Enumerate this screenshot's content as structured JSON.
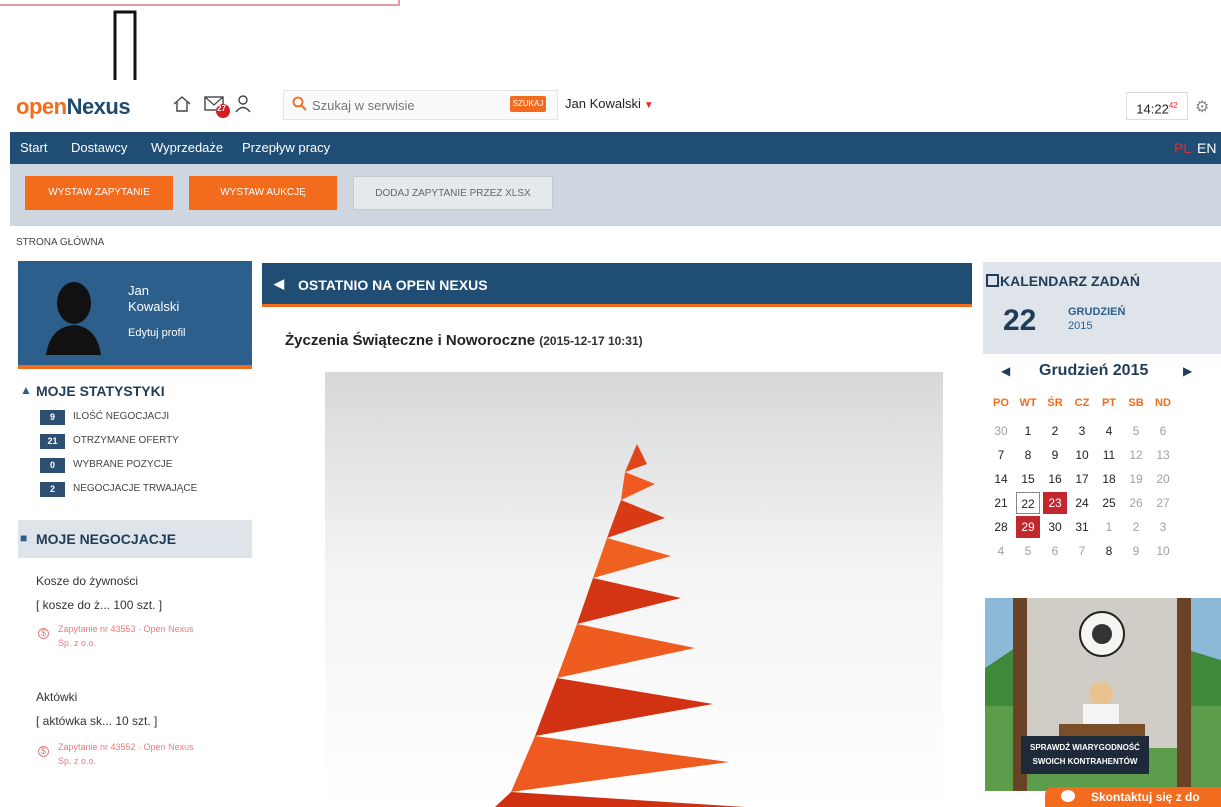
{
  "header": {
    "logo_part1": "open",
    "logo_part2": "Nexus",
    "search_placeholder": "Szukaj w serwisie",
    "search_button": "SZUKAJ",
    "messages_badge": "27",
    "user_name": "Jan Kowalski",
    "clock_time": "14:22",
    "clock_seconds": "42",
    "icons": [
      "home-icon",
      "messages-icon",
      "user-icon",
      "search-icon",
      "settings-icon"
    ]
  },
  "nav": {
    "items": [
      "Start",
      "Dostawcy",
      "Wyprzedaże",
      "Przepływ pracy"
    ],
    "lang_pl": "PL",
    "lang_en": "EN"
  },
  "actions": {
    "primary": "WYSTAW ZAPYTANIE",
    "auction": "WYSTAW AUKCJĘ",
    "xlsx": "DODAJ ZAPYTANIE PRZEZ XLSX"
  },
  "breadcrumb": "STRONA GŁÓWNA",
  "profile": {
    "first_name": "Jan",
    "last_name": "Kowalski",
    "edit_label": "Edytuj profil"
  },
  "stats": {
    "title": "MOJE STATYSTYKI",
    "items": [
      {
        "value": "9",
        "label": "ILOŚĆ NEGOCJACJI"
      },
      {
        "value": "21",
        "label": "OTRZYMANE OFERTY"
      },
      {
        "value": "0",
        "label": "WYBRANE POZYCJE"
      },
      {
        "value": "2",
        "label": "NEGOCJACJE TRWAJĄCE"
      }
    ]
  },
  "negotiations": {
    "title": "MOJE NEGOCJACJE",
    "items": [
      {
        "name": "Kosze do żywności",
        "detail": "[ kosze do ż... 100 szt. ]",
        "link_line1": "Zapytanie nr 43553 · Open Nexus",
        "link_line2": "Sp. z o.o."
      },
      {
        "name": "Aktówki",
        "detail": "[ aktówka sk... 10 szt. ]",
        "link_line1": "Zapytanie nr 43552 · Open Nexus",
        "link_line2": "Sp. z o.o."
      }
    ]
  },
  "news": {
    "section_title": "OSTATNIO NA OPEN NEXUS",
    "title": "Życzenia Świąteczne i Noworoczne",
    "date": "(2015-12-17 10:31)"
  },
  "calendar": {
    "title": "KALENDARZ ZADAŃ",
    "today_day": "22",
    "today_month": "GRUDZIEŃ",
    "today_year": "2015",
    "month_label": "Grudzień  2015",
    "weekdays": [
      "PO",
      "WT",
      "ŚR",
      "CZ",
      "PT",
      "SB",
      "ND"
    ],
    "weeks": [
      [
        "30",
        "1",
        "2",
        "3",
        "4",
        "5",
        "6"
      ],
      [
        "7",
        "8",
        "9",
        "10",
        "11",
        "12",
        "13"
      ],
      [
        "14",
        "15",
        "16",
        "17",
        "18",
        "19",
        "20"
      ],
      [
        "21",
        "22",
        "23",
        "24",
        "25",
        "26",
        "27"
      ],
      [
        "28",
        "29",
        "30",
        "31",
        "1",
        "2",
        "3"
      ],
      [
        "4",
        "5",
        "6",
        "7",
        "8",
        "9",
        "10"
      ]
    ]
  },
  "ad": {
    "line1": "SPRAWDŹ WIARYGODNOŚĆ",
    "line2": "SWOICH KONTRAHENTÓW"
  },
  "contact": "Skontaktuj się z do"
}
